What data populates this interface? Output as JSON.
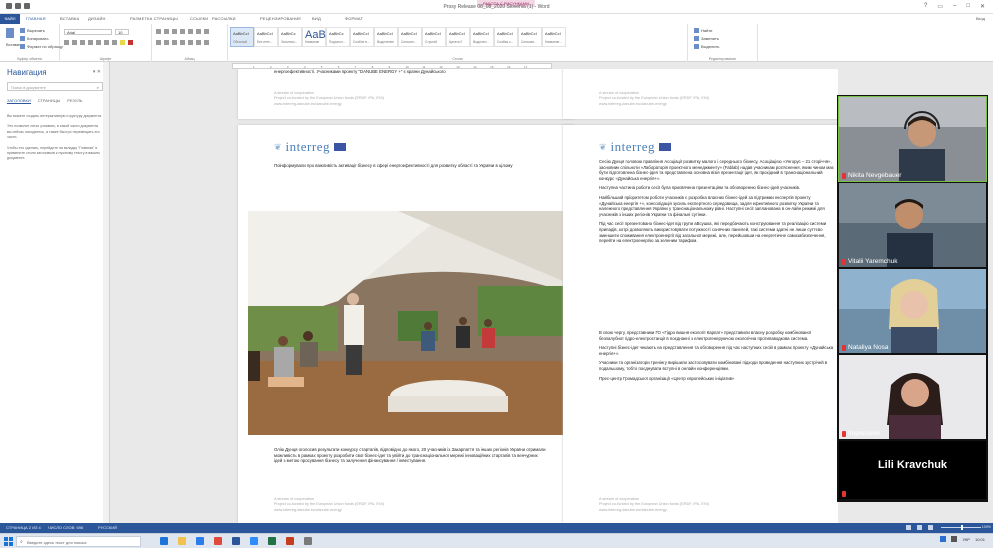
{
  "window": {
    "title": "Prosy Release 08_08_2020 Slovenia (1) - Word",
    "context_tab": "РАБОТА С РИСУНКАМИ",
    "window_controls": [
      "?",
      "▭",
      "–",
      "□",
      "✕"
    ]
  },
  "ribbon_tabs": {
    "file": "ФАЙЛ",
    "items": [
      "ГЛАВНАЯ",
      "ВСТАВКА",
      "ДИЗАЙН",
      "РАЗМЕТКА СТРАНИЦЫ",
      "ССЫЛКИ",
      "РАССЫЛКИ",
      "РЕЦЕНЗИРОВАНИЕ",
      "ВИД",
      "ФОРМАТ"
    ],
    "user": "Вход"
  },
  "ribbon": {
    "clipboard": {
      "paste": "Вставить",
      "cut": "Вырезать",
      "copy": "Копировать",
      "format_painter": "Формат по образцу",
      "label": "Буфер обмена"
    },
    "font": {
      "name": "Arial",
      "size": "10",
      "label": "Шрифт"
    },
    "paragraph": {
      "label": "Абзац"
    },
    "styles": {
      "label": "Стили",
      "items": [
        {
          "sample": "AaBbCcI",
          "name": "Обычный"
        },
        {
          "sample": "AaBbCcI",
          "name": "Без инте..."
        },
        {
          "sample": "AaBbCc",
          "name": "Заголово..."
        },
        {
          "sample": "AaB",
          "name": "Название"
        },
        {
          "sample": "AaBbCc",
          "name": "Подзагол..."
        },
        {
          "sample": "AaBbCcI",
          "name": "Слабое в..."
        },
        {
          "sample": "AaBbCcI",
          "name": "Выделение"
        },
        {
          "sample": "AaBbCcI",
          "name": "Сильное..."
        },
        {
          "sample": "AaBbCcI",
          "name": "Строгий"
        },
        {
          "sample": "AaBbCcI",
          "name": "Цитата 2"
        },
        {
          "sample": "AaBbCcI",
          "name": "Выделен..."
        },
        {
          "sample": "AaBbCcI",
          "name": "Слабая с..."
        },
        {
          "sample": "AaBbCcI",
          "name": "Сильная..."
        },
        {
          "sample": "AaBbCcI",
          "name": "Название..."
        }
      ]
    },
    "editing": {
      "find": "Найти",
      "replace": "Заменить",
      "select": "Выделить",
      "label": "Редактирование"
    }
  },
  "ruler_ticks": [
    "1",
    "2",
    "3",
    "4",
    "5",
    "6",
    "7",
    "8",
    "9",
    "10",
    "11",
    "12",
    "13",
    "14",
    "15",
    "16",
    "17"
  ],
  "nav_pane": {
    "title": "Навигация",
    "close": "▾ ✕",
    "search_placeholder": "Поиск в документе",
    "tabs": [
      "ЗАГОЛОВКИ",
      "СТРАНИЦЫ",
      "РЕЗУЛЬ"
    ],
    "paragraphs": [
      "Вы можете создать интерактивную структуру документа.",
      "Это позволит легко узнавать, в какой части документа вы сейчас находитесь, а также быстро перемещать его части.",
      "Чтобы это сделать, перейдите на вкладку \"Главная\" и примените стили заголовков к нужному тексту в вашем документе."
    ]
  },
  "document": {
    "top_left_text": "енергоефективності. Учасниками проекту \"DANUBE ENERGY +\" є країни Дунайського",
    "footer_title": "A stream of cooperation",
    "footer_line1": "Project co-funded by the European Union funds (ERDF, IPA, ENI)",
    "footer_line2": "www.interreg-danube.eu/danube-energy",
    "logo_text": "interreg",
    "page2_intro": "Поінформували про важливість активації бізнесу в сфері енергоефективності для розвитку області та України в цілому",
    "page2_bottom": "Олію Дунця оголосив результати конкурсу стартапів, відповідно до якого, 20 учасників із Закарпаття та інших регіонів України отримали можливість в рамках проекту розробити свої бізнес-ідеї та увійти до транснаціональної мережі інноваційних стартапів та венчурних ідей з метою просування бізнесу та залучення фінансування / інвестування.",
    "page3_paragraphs": [
      "Сесію Дунця головою правління Асоціації розвитку малого і середнього бізнесу, Асоціацією «Унгорус – 21 сторіччя», засновник спільноти «Лабораторія проектного менеджменту» (Fablab) надав учасникам роз'яснення, яким чином має бути підготовлена бізнес-ідея та представлена основна візія презентації ідеї, як прохідний в транснаціональний конкурс «Дунайська енергія+».",
      "Наступна частина роботи сесії була присвячена презентаціям та обговоренню бізнес-ідей учасників.",
      "Найбільший пріоритетом роботи учасників є розробка власних бізнес-ідей за підтримки експертів проекту «Дунайська енергія +», консолідація зусиль експертного середовища, задля ефективного розвитку України та належного представлення України у транснаціональному рівні. Наступні сесії запланована в он-лайн режимі для учасників з інших регіонів України та фінальні сутінки.",
      "Під час сесії презентовано бізнес-ідеї від групи аВсушка, які передбачають конструювання та реалізацію системи припадів, котрі дозволяють використовувати потужності сонячних панелей, такі системи здатні не лише суттєво зменшити споживання електроенергії від загальної мережі, але, перейшовши на енергетичне самозабезпечення, перейти на електроенергію за зеленим тарифом.",
      "В свою чергу, представники ГО «Гідро вишня екології Карпат» представили власну розробку комбінованої безпалубної гідро-електростанції в поєднанні з електрогенеруючою екологічна протипаводкова система.",
      "Наступні бізнес-ідеї чекають на представлення та обговорення під час наступних сесій в рамках проекту «Дунайська енергія+».",
      "Учасники та організатори тренінгу вирішили застосовувати комбіновані підходи проведення наступних зустрічей в подальшому, тобто поєднувати вступні в онлайн конференціями.",
      "Прес-центр Громадської організації «Центр європейських ініціатив»"
    ]
  },
  "zoom": {
    "participants": [
      {
        "name": "Nikita Nevgebauer",
        "video": true
      },
      {
        "name": "Vitalii Yaremchuk",
        "video": true
      },
      {
        "name": "Nataliya Nosa",
        "video": true
      },
      {
        "name": "Impression",
        "video": true
      },
      {
        "name": "Lili Kravchuk",
        "video": false
      }
    ]
  },
  "status_bar": {
    "page": "СТРАНИЦА 2 ИЗ 4",
    "words": "ЧИСЛО СЛОВ: 696",
    "lang": "РУССКИЙ",
    "zoom": "100%"
  },
  "taskbar": {
    "search_placeholder": "Введите здесь текст для поиска",
    "tray_lang": "УКР",
    "tray_time": "10:01"
  },
  "colors": {
    "word_blue": "#2b579a",
    "zoom_active_border": "#79c143",
    "zoom_mic_muted": "#e23434"
  }
}
